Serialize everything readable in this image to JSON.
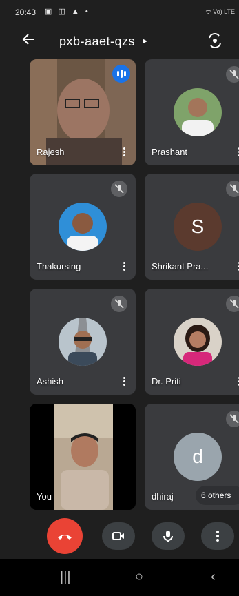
{
  "status": {
    "time": "20:43",
    "icons": "▣ ◫ ▲ •",
    "network": "ᯤ Vo) LTE"
  },
  "meeting": {
    "code": "pxb-aaet-qzs",
    "caret": "▸"
  },
  "tiles": [
    {
      "name": "Rajesh",
      "state": "speaking"
    },
    {
      "name": "Prashant",
      "state": "muted"
    },
    {
      "name": "Thakursing",
      "state": "muted"
    },
    {
      "name": "Shrikant Pra...",
      "state": "muted",
      "letter": "S",
      "color": "#5b3a2e"
    },
    {
      "name": "Ashish",
      "state": "muted"
    },
    {
      "name": "Dr. Priti",
      "state": "muted"
    },
    {
      "name": "You",
      "state": "video"
    },
    {
      "name": "dhiraj",
      "state": "muted",
      "letter": "d",
      "color": "#9aa5ad"
    }
  ],
  "others_label": "6 others",
  "controls": {
    "end": "end-call",
    "camera": "camera",
    "mic": "microphone",
    "more": "more"
  },
  "nav": {
    "recents": "|||",
    "home": "○",
    "back": "‹"
  }
}
